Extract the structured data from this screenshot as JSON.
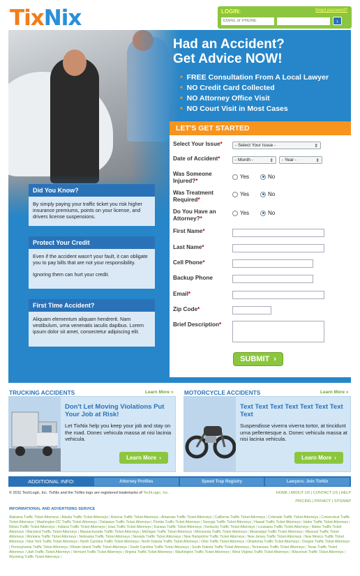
{
  "brand": {
    "part1": "Tix",
    "part2": "Nix"
  },
  "login": {
    "title": "LOGIN:",
    "forgot": "forgot password?",
    "email_placeholder": "EMAIL or PHONE",
    "go": "›"
  },
  "hero": {
    "headline_1": "Had an Accident?",
    "headline_2": "Get Advice NOW!",
    "bullets": [
      "FREE Consultation From A Local Lawyer",
      "NO Credit Card Collected",
      "NO Attorney Office Visit",
      "NO Court Visit in Most Cases"
    ]
  },
  "info_boxes": [
    {
      "title": "Did You Know?",
      "paras": [
        "By simply paying your traffic ticket you risk higher insurance premiums, points on your license, and drivers license suspensions."
      ]
    },
    {
      "title": "Protect Your Credit",
      "paras": [
        "Even if the accident wasn't your fault, it can obligate you to pay bills that are not your responsibility.",
        "Ignoring them can hurt your credit."
      ]
    },
    {
      "title": "First Time Accident?",
      "paras": [
        "Aliquam elementum aliquam hendrerit. Nam vestibulum, urna venenatis iaculis dapibus. Lorem ipsum dolor sit amet, consectetur adipiscing elit."
      ]
    }
  ],
  "form": {
    "title": "LET'S GET STARTED",
    "issue_label": "Select Your Issue",
    "issue_value": "- Select Your Issue -",
    "date_label": "Date of Accident",
    "month_value": "- Month -",
    "year_value": "- Year -",
    "injured_label_1": "Was Someone",
    "injured_label_2": "Injured?",
    "treatment_label_1": "Was Treatment",
    "treatment_label_2": "Required",
    "attorney_label_1": "Do You Have an",
    "attorney_label_2": "Attorney?",
    "yes": "Yes",
    "no": "No",
    "first_name": "First Name",
    "last_name": "Last Name",
    "cell_phone": "Cell Phone",
    "backup_phone": "Backup Phone",
    "email": "Email",
    "zip": "Zip Code",
    "description": "Brief Description",
    "required_mark": "*",
    "submit": "SUBMIT",
    "submit_arrow": "›"
  },
  "sections": {
    "trucking": {
      "title": "TRUCKING ACCIDENTS",
      "link": "Learn More »",
      "heading": "Don't Let Moving Violations Put Your Job at Risk!",
      "text": "Let TixNix help you keep your job and stay on the road. Donec vehicula massa at nisi lacinia vehicula.",
      "button": "Learn More"
    },
    "motorcycle": {
      "title": "MOTORCYCLE ACCIDENTS",
      "link": "Learn More »",
      "heading": "Text Text Text Text Text Text Text Text",
      "text": "Suspendisse viverra viverra tortor, at tincidunt urna pellentesque a. Donec vehicula massa at nisi lacinia vehicula.",
      "button": "Learn More"
    }
  },
  "additional": {
    "label": "ADDITIONAL INFO:",
    "tabs": [
      "Attorney Profiles",
      "Speed Trap Registry",
      "Lawyers: Join TixNix"
    ]
  },
  "footer": {
    "copyright": "© 2011 TechLogic, Inc. TixNix and the TixNix logo are registered trademarks of",
    "techlogic": "TechLogic, Inc.",
    "links_1": "HOME | ABOUT US | CONTACT US | HELP",
    "links_2": "PRICING | PRIVACY | SITEMAP",
    "service_title": "INFORMATIONAL AND ADVERTISING SERVICE",
    "attorney_links": [
      "Alabama Traffic Ticket Attorneys",
      "Alaska Traffic Ticket Attorneys",
      "Arizona Traffic Ticket Attorneys",
      "Arkansas Traffic Ticket Attorneys",
      "California Traffic Ticket Attorneys",
      "Colorado Traffic Ticket Attorneys",
      "Connecticut Traffic Ticket Attorneys",
      "Washington DC Traffic Ticket Attorneys",
      "Delaware Traffic Ticket Attorneys",
      "Florida Traffic Ticket Attorneys",
      "Georgia Traffic Ticket Attorneys",
      "Hawaii Traffic Ticket Attorneys",
      "Idaho Traffic Ticket Attorneys",
      "Illinois Traffic Ticket Attorneys",
      "Indiana Traffic Ticket Attorneys",
      "Iowa Traffic Ticket Attorneys",
      "Kansas Traffic Ticket Attorneys",
      "Kentucky Traffic Ticket Attorneys",
      "Louisiana Traffic Ticket Attorneys",
      "Maine Traffic Ticket Attorneys",
      "Maryland Traffic Ticket Attorneys",
      "Massachusetts Traffic Ticket Attorneys",
      "Michigan Traffic Ticket Attorneys",
      "Minnesota Traffic Ticket Attorneys",
      "Mississippi Traffic Ticket Attorneys",
      "Missouri Traffic Ticket Attorneys",
      "Montana Traffic Ticket Attorneys",
      "Nebraska Traffic Ticket Attorneys",
      "Nevada Traffic Ticket Attorneys",
      "New Hampshire Traffic Ticket Attorneys",
      "New Jersey Traffic Ticket Attorneys",
      "New Mexico Traffic Ticket Attorneys",
      "New York Traffic Ticket Attorneys",
      "North Carolina Traffic Ticket Attorneys",
      "North Dakota Traffic Ticket Attorneys",
      "Ohio Traffic Ticket Attorneys",
      "Oklahoma Traffic Ticket Attorneys",
      "Oregon Traffic Ticket Attorneys",
      "Pennsylvania Traffic Ticket Attorneys",
      "Rhode Island Traffic Ticket Attorneys",
      "South Carolina Traffic Ticket Attorneys",
      "South Dakota Traffic Ticket Attorneys",
      "Tennessee Traffic Ticket Attorneys",
      "Texas Traffic Ticket Attorneys",
      "Utah Traffic Ticket Attorneys",
      "Vermont Traffic Ticket Attorneys",
      "Virginia Traffic Ticket Attorneys",
      "Washington Traffic Ticket Attorneys",
      "West Virginia Traffic Ticket Attorneys",
      "Wisconsin Traffic Ticket Attorneys",
      "Wyoming Traffic Ticket Attorneys"
    ]
  }
}
